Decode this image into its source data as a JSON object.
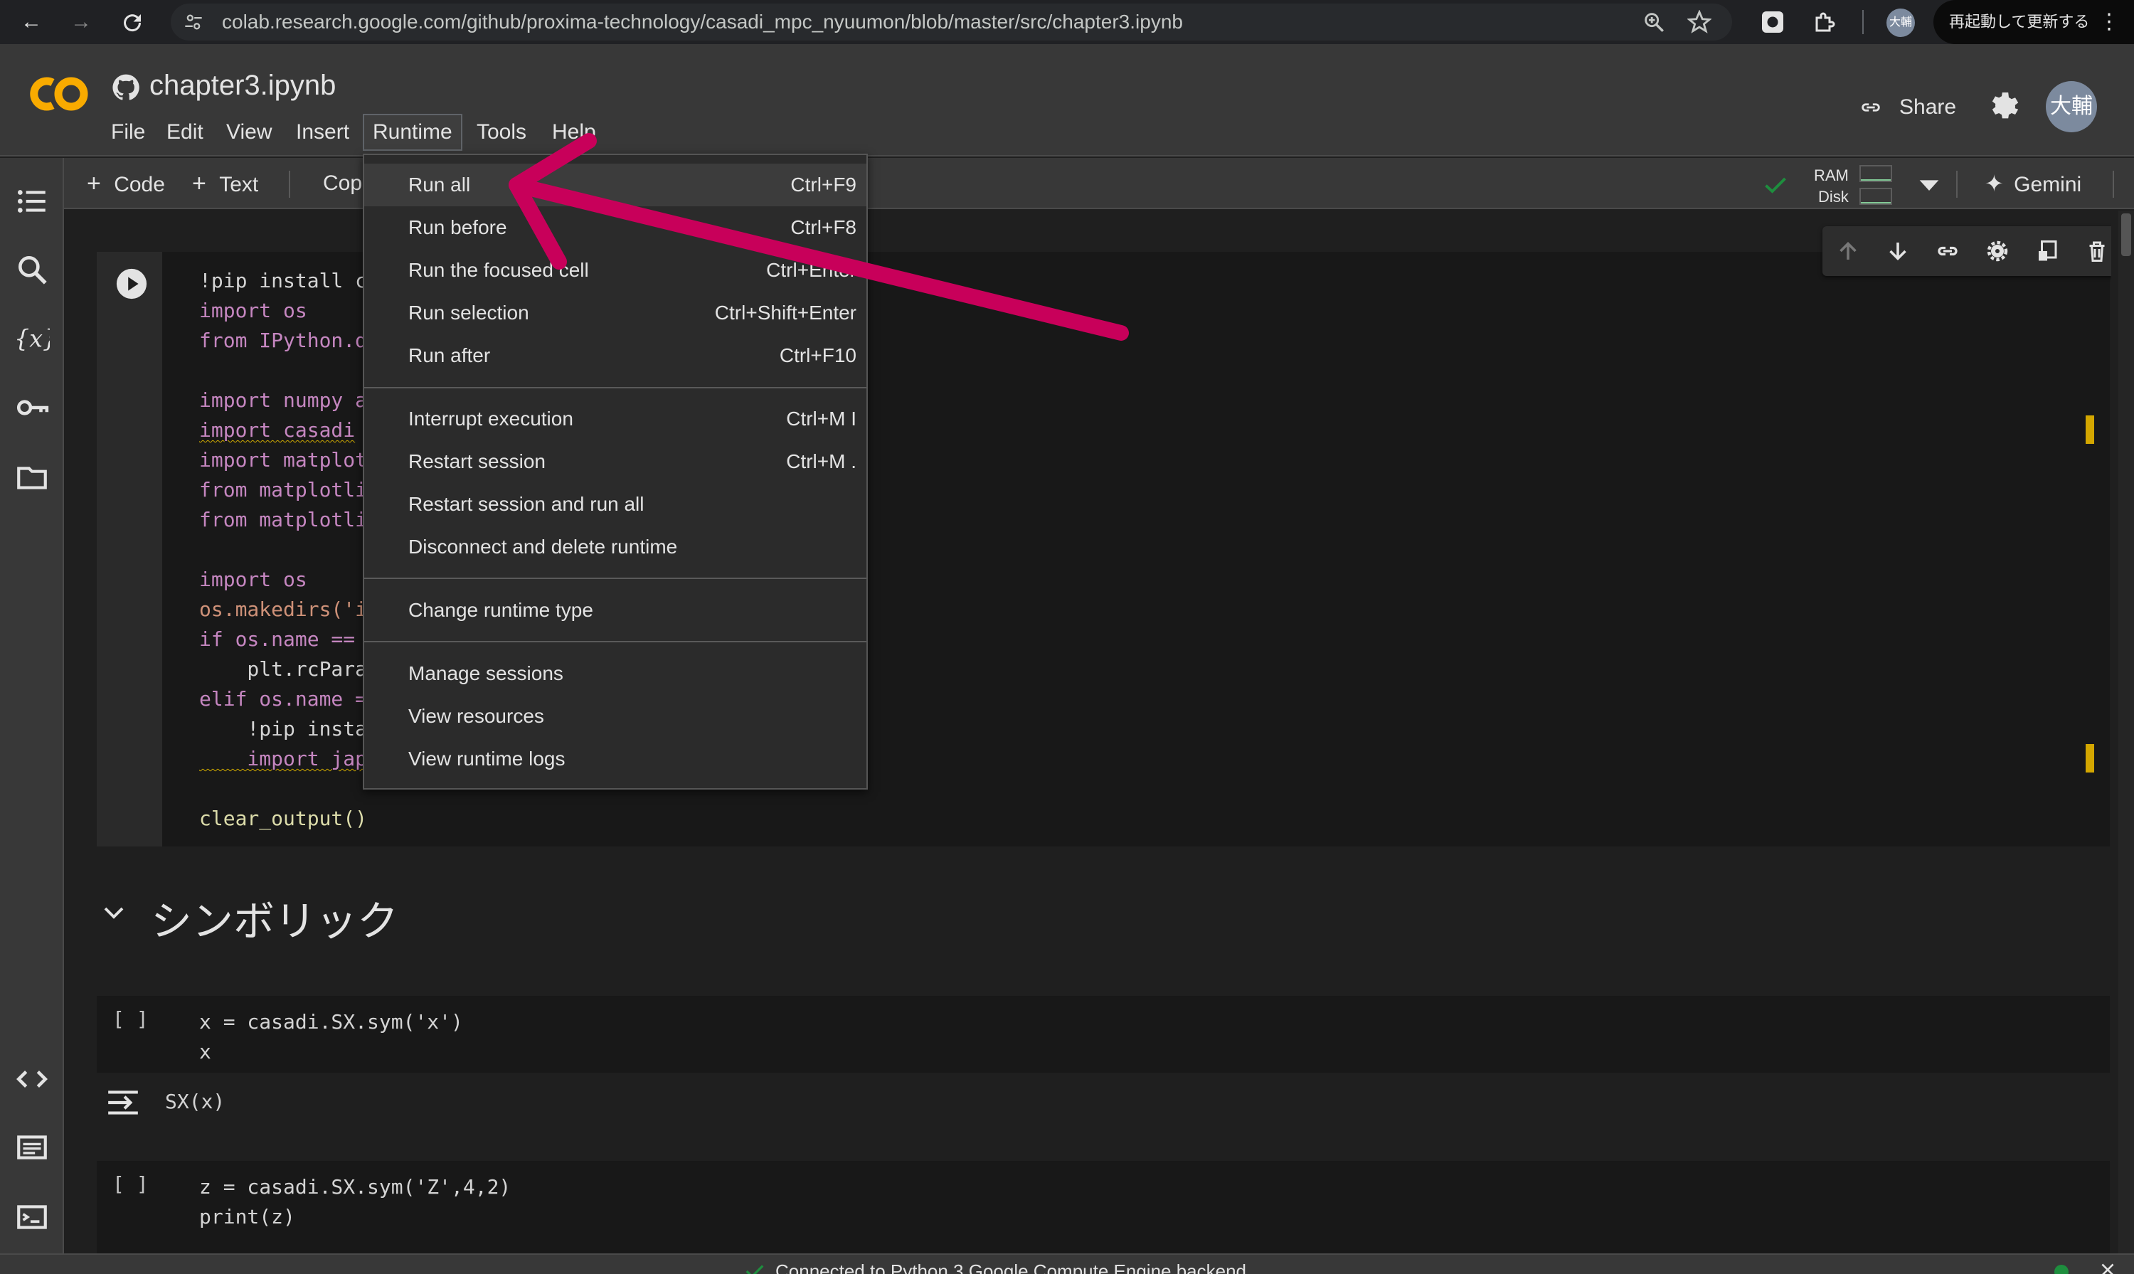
{
  "browser": {
    "url": "colab.research.google.com/github/proxima-technology/casadi_mpc_nyuumon/blob/master/src/chapter3.ipynb",
    "profile_initials": "大輔",
    "relaunch_label": "再起動して更新する"
  },
  "header": {
    "title": "chapter3.ipynb",
    "menu": [
      "File",
      "Edit",
      "View",
      "Insert",
      "Runtime",
      "Tools",
      "Help"
    ],
    "share_label": "Share",
    "avatar_initials": "大輔"
  },
  "toolbar": {
    "add_code": "Code",
    "add_text": "Text",
    "copy_partial": "Cop",
    "ram_label": "RAM",
    "disk_label": "Disk",
    "gemini_label": "Gemini"
  },
  "runtime_menu": {
    "groups": [
      [
        {
          "label": "Run all",
          "shortcut": "Ctrl+F9"
        },
        {
          "label": "Run before",
          "shortcut": "Ctrl+F8"
        },
        {
          "label": "Run the focused cell",
          "shortcut": "Ctrl+Enter"
        },
        {
          "label": "Run selection",
          "shortcut": "Ctrl+Shift+Enter"
        },
        {
          "label": "Run after",
          "shortcut": "Ctrl+F10"
        }
      ],
      [
        {
          "label": "Interrupt execution",
          "shortcut": "Ctrl+M I"
        },
        {
          "label": "Restart session",
          "shortcut": "Ctrl+M ."
        },
        {
          "label": "Restart session and run all",
          "shortcut": ""
        },
        {
          "label": "Disconnect and delete runtime",
          "shortcut": ""
        }
      ],
      [
        {
          "label": "Change runtime type",
          "shortcut": ""
        }
      ],
      [
        {
          "label": "Manage sessions",
          "shortcut": ""
        },
        {
          "label": "View resources",
          "shortcut": ""
        },
        {
          "label": "View runtime logs",
          "shortcut": ""
        }
      ]
    ]
  },
  "cells": {
    "cell1_lines": [
      "!pip install casa",
      "import os",
      "from IPython.disp",
      "",
      "import numpy as n",
      "import casadi",
      "import matplotlib",
      "from matplotlib.c",
      "from matplotlib i",
      "",
      "import os",
      "os.makedirs('imag",
      "if os.name == 'nt",
      "    plt.rcParams[",
      "elif os.name == '",
      "    !pip install ",
      "    import japani",
      "",
      "clear_output()"
    ],
    "section_heading": "シンボリック",
    "cell2_bracket": "[ ]",
    "cell2_lines": [
      "x = casadi.SX.sym('x')",
      "x"
    ],
    "cell2_output": "SX(x)",
    "cell3_bracket": "[ ]",
    "cell3_lines": [
      "z = casadi.SX.sym('Z',4,2)",
      "print(z)"
    ]
  },
  "status": {
    "text": "Connected to Python 3 Google Compute Engine backend"
  },
  "colors": {
    "accent_orange": "#f9ab00",
    "annotation_arrow": "#c8005a",
    "connected_green": "#1e8e3e"
  }
}
